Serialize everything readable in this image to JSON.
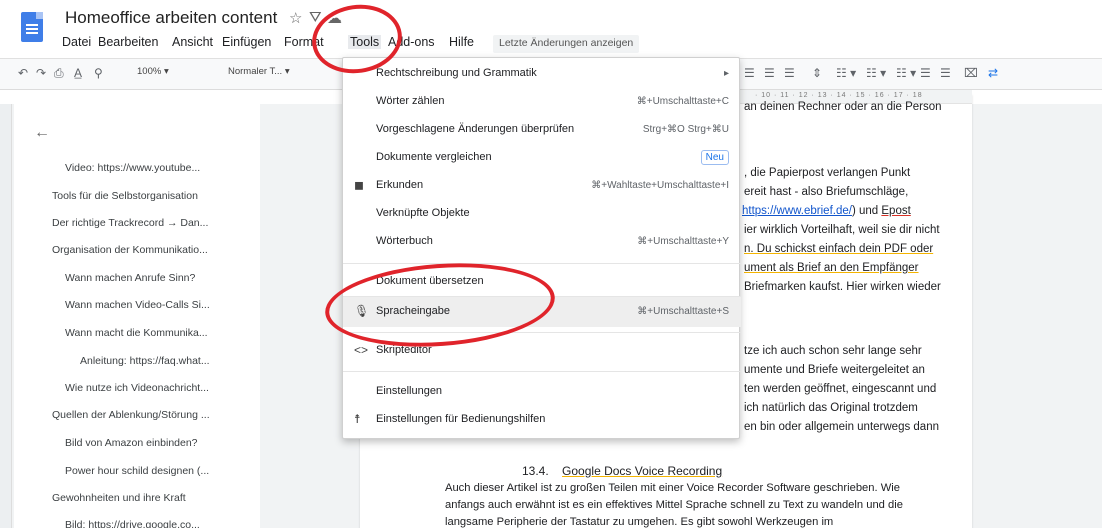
{
  "header": {
    "title": "Homeoffice arbeiten content",
    "star": "☆",
    "drive": "⛛",
    "cloud": "☁"
  },
  "menubar": {
    "items": [
      "Datei",
      "Bearbeiten",
      "Ansicht",
      "Einfügen",
      "Format",
      "Tools",
      "Add-ons",
      "Hilfe"
    ],
    "last_changes": "Letzte Änderungen anzeigen"
  },
  "toolbar": {
    "zoom": "100%",
    "style": "Normaler T..."
  },
  "ruler": {
    "numbers": "· 10 · 11 · 12 · 13 · 14 · 15 · 16 · 17 · 18"
  },
  "outline": {
    "items": [
      "Video: https://www.youtube...",
      "Tools für die Selbstorganisation",
      "Der richtige Trackrecord → Dan...",
      "Organisation der Kommunikatio...",
      "Wann machen Anrufe Sinn?",
      "Wann machen Video-Calls Si...",
      "Wann macht die Kommunika...",
      "Anleitung: https://faq.what...",
      "Wie nutze ich Videonachricht...",
      "Quellen der Ablenkung/Störung ...",
      "Bild von Amazon einbinden?",
      "Power hour schild designen (...",
      "Gewohnheiten und ihre Kraft",
      "Bild: https://drive.google.co..."
    ]
  },
  "tools_menu": {
    "items": [
      {
        "label": "Rechtschreibung und Grammatik",
        "shortcut": "▸"
      },
      {
        "label": "Wörter zählen",
        "shortcut": "⌘+Umschalttaste+C"
      },
      {
        "label": "Vorgeschlagene Änderungen überprüfen",
        "shortcut": "Strg+⌘O Strg+⌘U"
      },
      {
        "label": "Dokumente vergleichen",
        "badge": "Neu"
      },
      {
        "label": "Erkunden",
        "shortcut": "⌘+Wahltaste+Umschalttaste+I"
      },
      {
        "label": "Verknüpfte Objekte"
      },
      {
        "label": "Wörterbuch",
        "shortcut": "⌘+Umschalttaste+Y"
      },
      {
        "label": "Dokument übersetzen"
      },
      {
        "label": "Spracheingabe",
        "shortcut": "⌘+Umschalttaste+S"
      },
      {
        "label": "Skripteditor"
      },
      {
        "label": "Einstellungen"
      },
      {
        "label": "Einstellungen für Bedienungshilfen"
      }
    ]
  },
  "document": {
    "lines": [
      "an deinen Rechner oder an die Person",
      ", die Papierpost verlangen Punkt",
      "ereit hast - also Briefumschläge,",
      "https://www.ebrief.de/",
      ") und ",
      "Epost",
      "ier wirklich Vorteilhaft, weil sie dir nicht",
      "n. Du schickst einfach dein PDF oder",
      "ument als Brief an den Empfänger",
      "Briefmarken kaufst. Hier wirken wieder",
      "tze ich auch schon sehr lange sehr",
      "umente und Briefe weitergeleitet an",
      "ten werden geöffnet, eingescannt und",
      "ich natürlich das Original trotzdem",
      "en bin oder allgemein unterwegs dann"
    ],
    "heading_number": "13.4.",
    "heading_text": "Google Docs Voice Recording",
    "para": [
      "Auch dieser Artikel ist zu großen Teilen mit einer Voice Recorder Software geschrieben. Wie",
      "anfangs auch erwähnt ist es ein effektives Mittel Sprache schnell zu Text zu wandeln und die",
      "langsame Peripherie der Tastatur zu umgehen. Es gibt sowohl Werkzeugen im"
    ]
  },
  "colors": {
    "annotation": "#e0242b",
    "link": "#1155cc",
    "accent": "#1a73e8"
  }
}
